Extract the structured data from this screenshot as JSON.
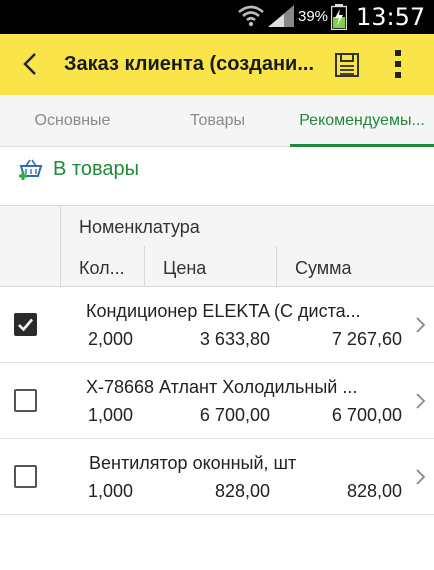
{
  "status_bar": {
    "battery_pct": "39%",
    "time": "13:57"
  },
  "header": {
    "title": "Заказ клиента (создани...",
    "icons": [
      "back-arrow-icon",
      "save-icon",
      "more-vert-icon"
    ]
  },
  "tabs": [
    {
      "label": "Основные",
      "active": false
    },
    {
      "label": "Товары",
      "active": false
    },
    {
      "label": "Рекомендуемы...",
      "active": true
    }
  ],
  "action": {
    "label": "В товары",
    "icon": "add-to-cart-icon"
  },
  "table": {
    "columns": {
      "name": "Номенклатура",
      "qty": "Кол...",
      "price": "Цена",
      "sum": "Сумма"
    },
    "rows": [
      {
        "checked": true,
        "name": "Кондиционер ELEKTA (С диста...",
        "qty": "2,000",
        "price": "3 633,80",
        "sum": "7 267,60"
      },
      {
        "checked": false,
        "name": "Х-78668 Атлант Холодильный ...",
        "qty": "1,000",
        "price": "6 700,00",
        "sum": "6 700,00"
      },
      {
        "checked": false,
        "name": "Вентилятор оконный, шт",
        "qty": "1,000",
        "price": "828,00",
        "sum": "828,00"
      }
    ]
  },
  "colors": {
    "header_bg": "#f9e44a",
    "accent_green": "#1f8a3a"
  }
}
